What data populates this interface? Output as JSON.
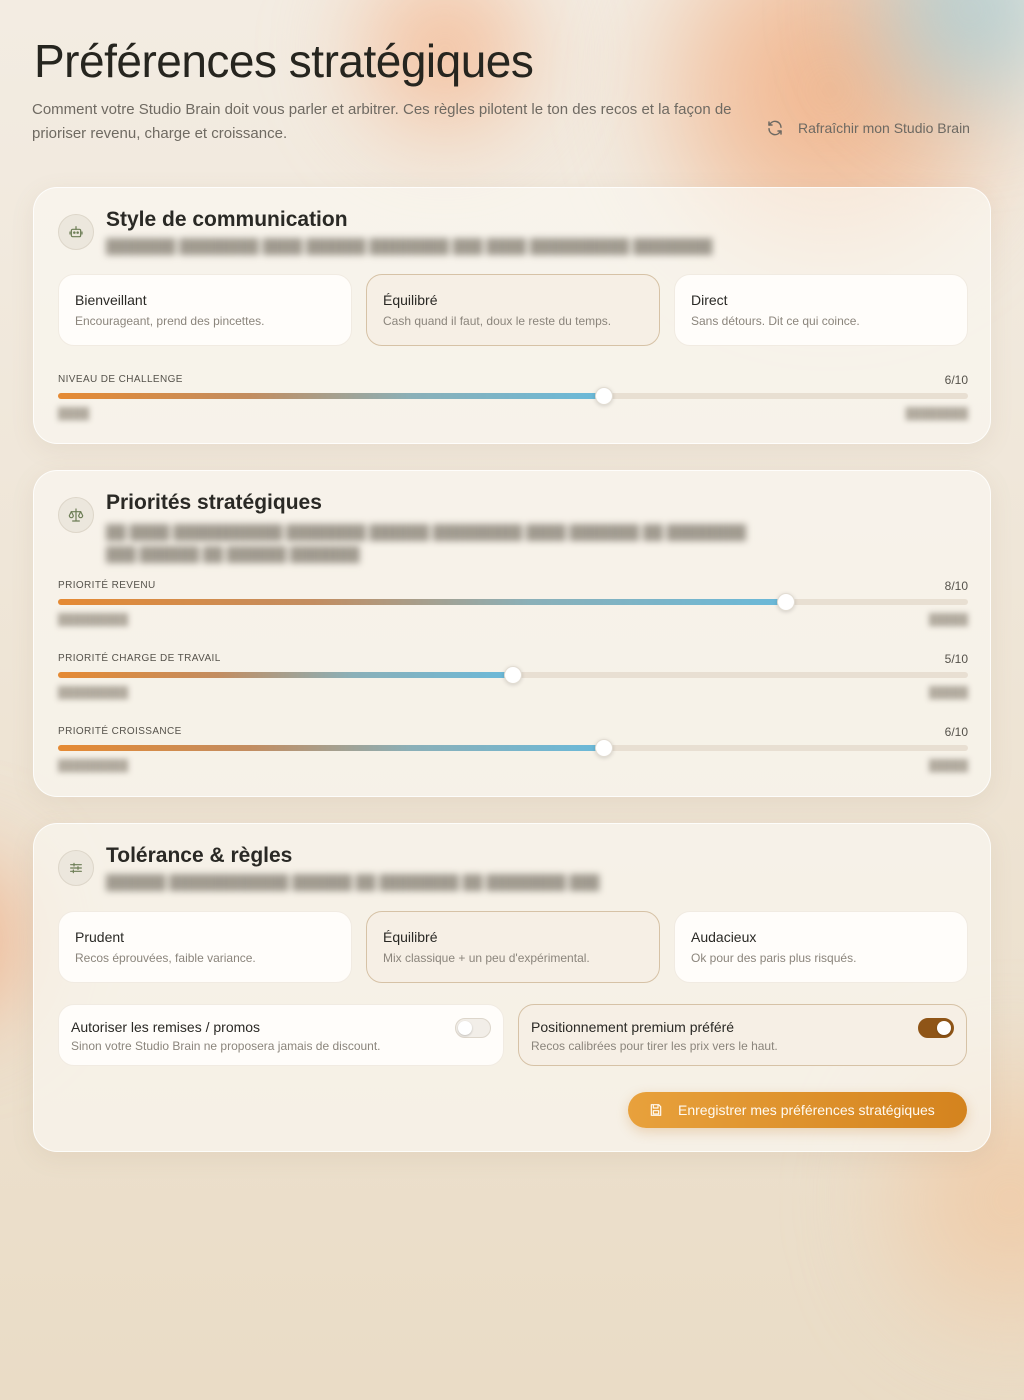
{
  "header": {
    "title": "Préférences stratégiques",
    "subtitle": "Comment votre Studio Brain doit vous parler et arbitrer. Ces règles pilotent le ton des recos et la façon de prioriser revenu, charge et croissance.",
    "refresh_label": "Rafraîchir mon Studio Brain",
    "refresh_icon": "refresh-icon"
  },
  "communication": {
    "icon": "robot-icon",
    "title": "Style de communication",
    "options": [
      {
        "title": "Bienveillant",
        "desc": "Encourageant, prend des pincettes.",
        "selected": false
      },
      {
        "title": "Équilibré",
        "desc": "Cash quand il faut, doux le reste du temps.",
        "selected": true
      },
      {
        "title": "Direct",
        "desc": "Sans détours. Dit ce qui coince.",
        "selected": false
      }
    ],
    "challenge": {
      "label": "NIVEAU DE CHALLENGE",
      "value_text": "6/10",
      "value": 6,
      "max": 10
    }
  },
  "priorities": {
    "icon": "scale-icon",
    "title": "Priorités stratégiques",
    "sliders": [
      {
        "label": "PRIORITÉ REVENU",
        "value_text": "8/10",
        "value": 8,
        "max": 10
      },
      {
        "label": "PRIORITÉ CHARGE DE TRAVAIL",
        "value_text": "5/10",
        "value": 5,
        "max": 10
      },
      {
        "label": "PRIORITÉ CROISSANCE",
        "value_text": "6/10",
        "value": 6,
        "max": 10
      }
    ]
  },
  "tolerance": {
    "icon": "sliders-icon",
    "title": "Tolérance & règles",
    "options": [
      {
        "title": "Prudent",
        "desc": "Recos éprouvées, faible variance.",
        "selected": false
      },
      {
        "title": "Équilibré",
        "desc": "Mix classique + un peu d'expérimental.",
        "selected": true
      },
      {
        "title": "Audacieux",
        "desc": "Ok pour des paris plus risqués.",
        "selected": false
      }
    ],
    "toggles": [
      {
        "title": "Autoriser les remises / promos",
        "desc": "Sinon votre Studio Brain ne proposera jamais de discount.",
        "on": false
      },
      {
        "title": "Positionnement premium préféré",
        "desc": "Recos calibrées pour tirer les prix vers le haut.",
        "on": true
      }
    ],
    "save_label": "Enregistrer mes préférences stratégiques",
    "save_icon": "save-icon"
  },
  "colors": {
    "accent": "#d4831e",
    "toggle_on": "#8f5517",
    "selected_border": "#d6c2a6"
  }
}
